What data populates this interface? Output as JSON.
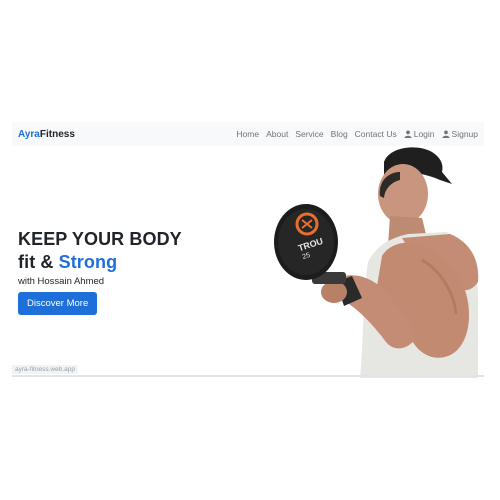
{
  "brand": {
    "part1": "Ayra",
    "part2": "Fitness"
  },
  "nav": {
    "home": "Home",
    "about": "About",
    "service": "Service",
    "blog": "Blog",
    "contact": "Contact Us",
    "login": "Login",
    "signup": "Signup"
  },
  "hero": {
    "line1": "KEEP YOUR BODY",
    "line2_plain": "fit & ",
    "line2_accent": "Strong",
    "byline": "with Hossain Ahmed",
    "cta": "Discover More"
  },
  "dumbbell": {
    "brand": "TROU",
    "weight": "25"
  },
  "status_url": "ayra-fitness.web.app",
  "colors": {
    "accent": "#1e6fd9",
    "navbar_bg": "#f8f9fa",
    "text": "#212529",
    "muted": "#6c757d"
  }
}
